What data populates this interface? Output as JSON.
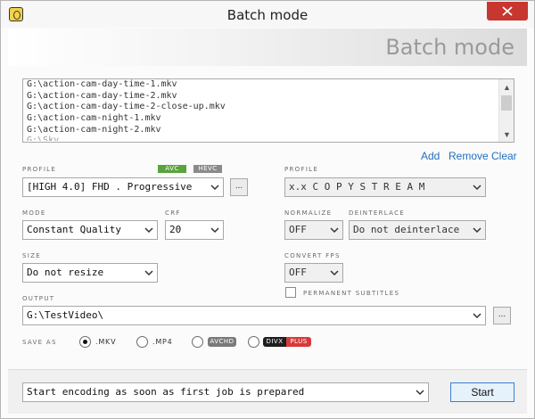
{
  "window": {
    "title": "Batch mode"
  },
  "header": {
    "title": "Batch mode"
  },
  "files": [
    "G:\\action-cam-day-time-1.mkv",
    "G:\\action-cam-day-time-2.mkv",
    "G:\\action-cam-day-time-2-close-up.mkv",
    "G:\\action-cam-night-1.mkv",
    "G:\\action-cam-night-2.mkv",
    "G:\\Sky..."
  ],
  "list_actions": {
    "add": "Add",
    "remove": "Remove",
    "clear": "Clear"
  },
  "video": {
    "profile_label": "PROFILE",
    "badge_avc": "AVC",
    "badge_hevc": "HEVC",
    "profile_value": "[HIGH 4.0] FHD . Progressive",
    "profile_more": "...",
    "mode_label": "MODE",
    "mode_value": "Constant Quality",
    "crf_label": "CRF",
    "crf_value": "20",
    "size_label": "SIZE",
    "size_value": "Do not resize"
  },
  "audio": {
    "profile_label": "PROFILE",
    "profile_value": "x.x C O P Y   S T R E A M",
    "normalize_label": "NORMALIZE",
    "normalize_value": "OFF",
    "deinterlace_label": "DEINTERLACE",
    "deinterlace_value": "Do not deinterlace",
    "convert_fps_label": "CONVERT FPS",
    "convert_fps_value": "OFF",
    "permanent_subtitles_label": "PERMANENT SUBTITLES",
    "permanent_subtitles_checked": false
  },
  "output": {
    "label": "OUTPUT",
    "value": "G:\\TestVideo\\",
    "browse": "..."
  },
  "save_as": {
    "label": "SAVE AS",
    "selected": ".MKV",
    "options": [
      ".MKV",
      ".MP4",
      "AVCHD",
      "DIVX",
      "PLUS"
    ]
  },
  "footer": {
    "start_mode": "Start encoding as soon as first job is prepared",
    "start_button": "Start"
  },
  "colors": {
    "link": "#1f6fc2",
    "avc": "#5aa33e",
    "hevc": "#8a8a8a",
    "divx_red": "#d63a3a",
    "close": "#c7372f"
  }
}
